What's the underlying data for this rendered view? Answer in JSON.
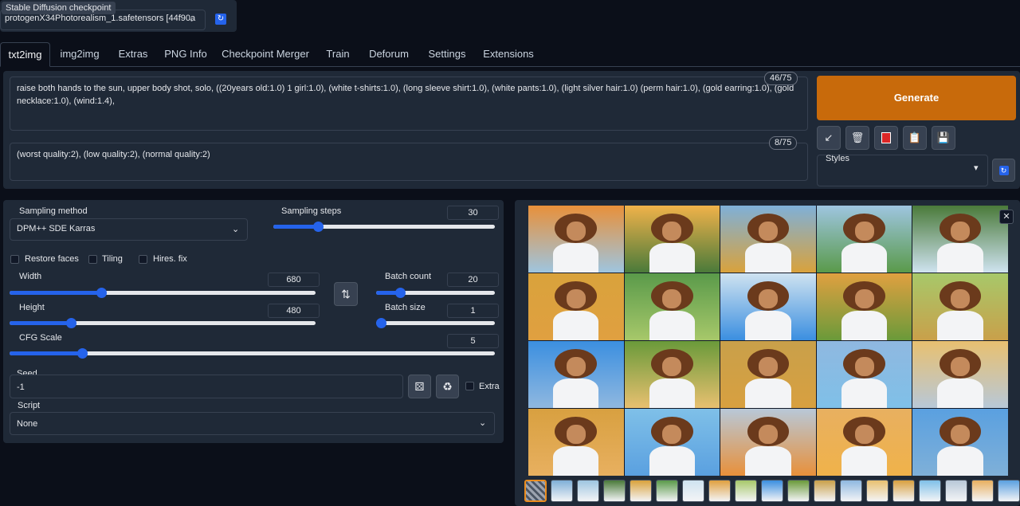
{
  "checkpoint": {
    "label": "Stable Diffusion checkpoint",
    "value": "protogenX34Photorealism_1.safetensors [44f90a",
    "refresh_icon": "refresh-icon"
  },
  "tabs": [
    {
      "label": "txt2img"
    },
    {
      "label": "img2img"
    },
    {
      "label": "Extras"
    },
    {
      "label": "PNG Info"
    },
    {
      "label": "Checkpoint Merger"
    },
    {
      "label": "Train"
    },
    {
      "label": "Deforum"
    },
    {
      "label": "Settings"
    },
    {
      "label": "Extensions"
    }
  ],
  "prompt": {
    "text": "raise both hands to the sun, upper body shot, solo, ((20years old:1.0) 1 girl:1.0), (white t-shirts:1.0), (long sleeve shirt:1.0), (white pants:1.0), (light silver hair:1.0) (perm hair:1.0), (gold earring:1.0), (gold necklace:1.0), (wind:1.4),",
    "counter": "46/75"
  },
  "negative_prompt": {
    "text": "(worst quality:2), (low quality:2), (normal quality:2)",
    "counter": "8/75"
  },
  "generate_label": "Generate",
  "tool_icons": [
    "arrow-icon",
    "trash-icon",
    "red-card-icon",
    "clipboard-icon",
    "save-icon"
  ],
  "styles": {
    "label": "Styles",
    "value": ""
  },
  "sampling": {
    "method_label": "Sampling method",
    "method_value": "DPM++ SDE Karras",
    "steps_label": "Sampling steps",
    "steps_value": "30",
    "steps_fraction": 0.2
  },
  "checkboxes": {
    "restore_faces": "Restore faces",
    "tiling": "Tiling",
    "hires_fix": "Hires. fix"
  },
  "width": {
    "label": "Width",
    "value": "680",
    "fraction": 0.3
  },
  "height": {
    "label": "Height",
    "value": "480",
    "fraction": 0.2
  },
  "batch_count": {
    "label": "Batch count",
    "value": "20",
    "fraction": 0.2
  },
  "batch_size": {
    "label": "Batch size",
    "value": "1",
    "fraction": 0.0
  },
  "cfg": {
    "label": "CFG Scale",
    "value": "5",
    "fraction": 0.15
  },
  "seed": {
    "label": "Seed",
    "value": "-1",
    "extra_label": "Extra"
  },
  "script": {
    "label": "Script",
    "value": "None"
  },
  "gallery": {
    "close_icon": "close-icon",
    "rows": 4,
    "cols": 5,
    "thumb_count": 19
  },
  "colors": {
    "accent": "#2563eb",
    "generate": "#c86a0b",
    "bg": "#0b0f19",
    "panel": "#1f2937"
  }
}
